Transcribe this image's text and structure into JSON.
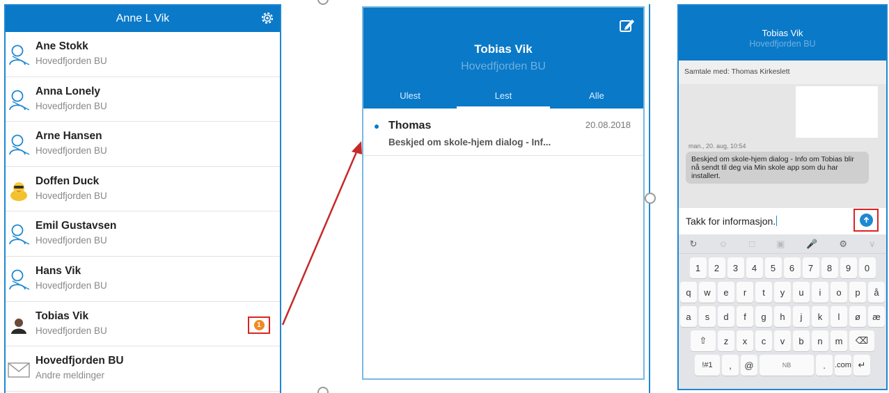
{
  "contact_list": {
    "title": "Anne L Vik",
    "contacts": [
      {
        "name": "Ane Stokk",
        "group": "Hovedfjorden BU",
        "avatar": "person-outline-icon"
      },
      {
        "name": "Anna Lonely",
        "group": "Hovedfjorden BU",
        "avatar": "person-outline-icon"
      },
      {
        "name": "Arne Hansen",
        "group": "Hovedfjorden BU",
        "avatar": "person-outline-icon"
      },
      {
        "name": "Doffen Duck",
        "group": "Hovedfjorden BU",
        "avatar": "duck-avatar-icon"
      },
      {
        "name": "Emil Gustavsen",
        "group": "Hovedfjorden BU",
        "avatar": "person-outline-icon"
      },
      {
        "name": "Hans Vik",
        "group": "Hovedfjorden BU",
        "avatar": "person-outline-icon"
      },
      {
        "name": "Tobias Vik",
        "group": "Hovedfjorden BU",
        "avatar": "person-photo-icon",
        "unread": "1"
      },
      {
        "name": "Hovedfjorden BU",
        "group": "Andre meldinger",
        "avatar": "envelope-icon"
      }
    ]
  },
  "message_list": {
    "title": "Tobias Vik",
    "subtitle": "Hovedfjorden BU",
    "tabs": [
      "Ulest",
      "Lest",
      "Alle"
    ],
    "active_tab": "Lest",
    "messages": [
      {
        "from": "Thomas",
        "date": "20.08.2018",
        "subject": "Beskjed om skole-hjem dialog - Inf..."
      }
    ]
  },
  "conversation": {
    "title": "Tobias Vik",
    "subtitle": "Hovedfjorden BU",
    "participant_label": "Samtale med:",
    "participant": "Thomas Kirkeslett",
    "timestamp": "man., 20. aug, 10:54",
    "message": "Beskjed om skole-hjem dialog - Info om Tobias blir nå sendt til deg via Min skole app som du har installert.",
    "draft": "Takk for informasjon."
  },
  "keyboard": {
    "row_numbers": [
      "1",
      "2",
      "3",
      "4",
      "5",
      "6",
      "7",
      "8",
      "9",
      "0"
    ],
    "row_1": [
      "q",
      "w",
      "e",
      "r",
      "t",
      "y",
      "u",
      "i",
      "o",
      "p",
      "å"
    ],
    "row_2": [
      "a",
      "s",
      "d",
      "f",
      "g",
      "h",
      "j",
      "k",
      "l",
      "ø",
      "æ"
    ],
    "row_3": [
      "z",
      "x",
      "c",
      "v",
      "b",
      "n",
      "m"
    ],
    "symbols_key": "!#1",
    "comma_key": ",",
    "at_key": "@",
    "space_label": "NB",
    "period_key": ".",
    "com_key": ".com"
  },
  "colors": {
    "primary": "#0a79c8",
    "badge": "#f08a24",
    "highlight_box": "#dd2222",
    "arrow": "#c62828"
  }
}
